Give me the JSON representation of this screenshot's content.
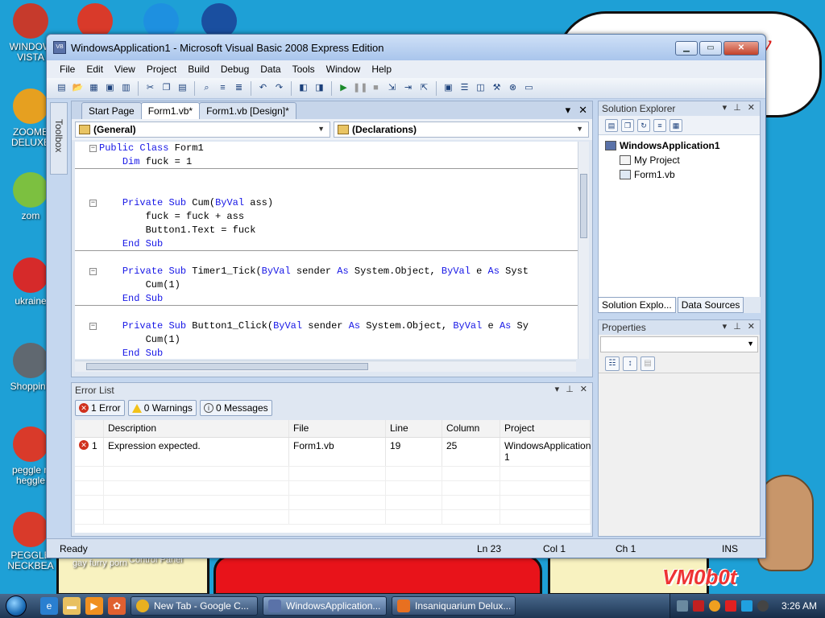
{
  "desktop": {
    "icons": [
      {
        "label": "WINDOW VISTA",
        "color": "#c63a2c"
      },
      {
        "label": "ZOOME DELUXE",
        "color": "#e6a020"
      },
      {
        "label": "zom",
        "color": "#7cc040"
      },
      {
        "label": "ukraine",
        "color": "#d62a2a"
      },
      {
        "label": "Shopping",
        "color": "#606870"
      },
      {
        "label": "peggle n heggle",
        "color": "#d93a2a"
      },
      {
        "label": "PEGGLE NECKBEA",
        "color": "#d93a2a"
      }
    ],
    "under_labels": [
      "gay furry porn",
      "Control Panel"
    ],
    "watermark": "VM0b0t",
    "cloud_text": "it y"
  },
  "ide": {
    "title": "WindowsApplication1 - Microsoft Visual Basic 2008 Express Edition",
    "app_icon": "VB",
    "menu": [
      "File",
      "Edit",
      "View",
      "Project",
      "Build",
      "Debug",
      "Data",
      "Tools",
      "Window",
      "Help"
    ],
    "toolbox_label": "Toolbox",
    "doc_tabs": [
      "Start Page",
      "Form1.vb*",
      "Form1.vb [Design]*"
    ],
    "active_tab_index": 1,
    "dropdown_left": "(General)",
    "dropdown_right": "(Declarations)",
    "code": [
      {
        "text": "Public Class Form1",
        "collapse": true,
        "indent": 0
      },
      {
        "text": "    Dim fuck = 1",
        "collapse": false,
        "indent": 0,
        "sep": true
      },
      {
        "text": "",
        "collapse": false
      },
      {
        "text": "",
        "collapse": false
      },
      {
        "text": "    Private Sub Cum(ByVal ass)",
        "collapse": true
      },
      {
        "text": "        fuck = fuck + ass",
        "collapse": false
      },
      {
        "text": "        Button1.Text = fuck",
        "collapse": false
      },
      {
        "text": "    End Sub",
        "collapse": false,
        "sep": true
      },
      {
        "text": "",
        "collapse": false
      },
      {
        "text": "    Private Sub Timer1_Tick(ByVal sender As System.Object, ByVal e As Syst",
        "collapse": true
      },
      {
        "text": "        Cum(1)",
        "collapse": false
      },
      {
        "text": "    End Sub",
        "collapse": false,
        "sep": true
      },
      {
        "text": "",
        "collapse": false
      },
      {
        "text": "    Private Sub Button1_Click(ByVal sender As System.Object, ByVal e As Sy",
        "collapse": true
      },
      {
        "text": "        Cum(1)",
        "collapse": false
      },
      {
        "text": "    End Sub",
        "collapse": false
      }
    ],
    "error_list": {
      "title": "Error List",
      "filters": {
        "errors": "1 Error",
        "warnings": "0 Warnings",
        "messages": "0 Messages"
      },
      "columns": [
        "",
        "Description",
        "File",
        "Line",
        "Column",
        "Project"
      ],
      "rows": [
        {
          "num": "1",
          "description": "Expression expected.",
          "file": "Form1.vb",
          "line": "19",
          "column": "25",
          "project": "WindowsApplication 1"
        }
      ]
    },
    "solution_explorer": {
      "title": "Solution Explorer",
      "root": "WindowsApplication1",
      "items": [
        "My Project",
        "Form1.vb"
      ],
      "tabs": [
        "Solution Explo...",
        "Data Sources"
      ]
    },
    "properties": {
      "title": "Properties"
    },
    "status": {
      "ready": "Ready",
      "ln": "Ln 23",
      "col": "Col 1",
      "ch": "Ch 1",
      "mode": "INS"
    }
  },
  "taskbar": {
    "buttons": [
      {
        "label": "New Tab - Google C...",
        "color": "#e9b020"
      },
      {
        "label": "WindowsApplication...",
        "color": "#5a72a8"
      },
      {
        "label": "Insaniquarium Delux...",
        "color": "#e87020"
      }
    ],
    "active_index": 1,
    "clock": "3:26 AM"
  }
}
